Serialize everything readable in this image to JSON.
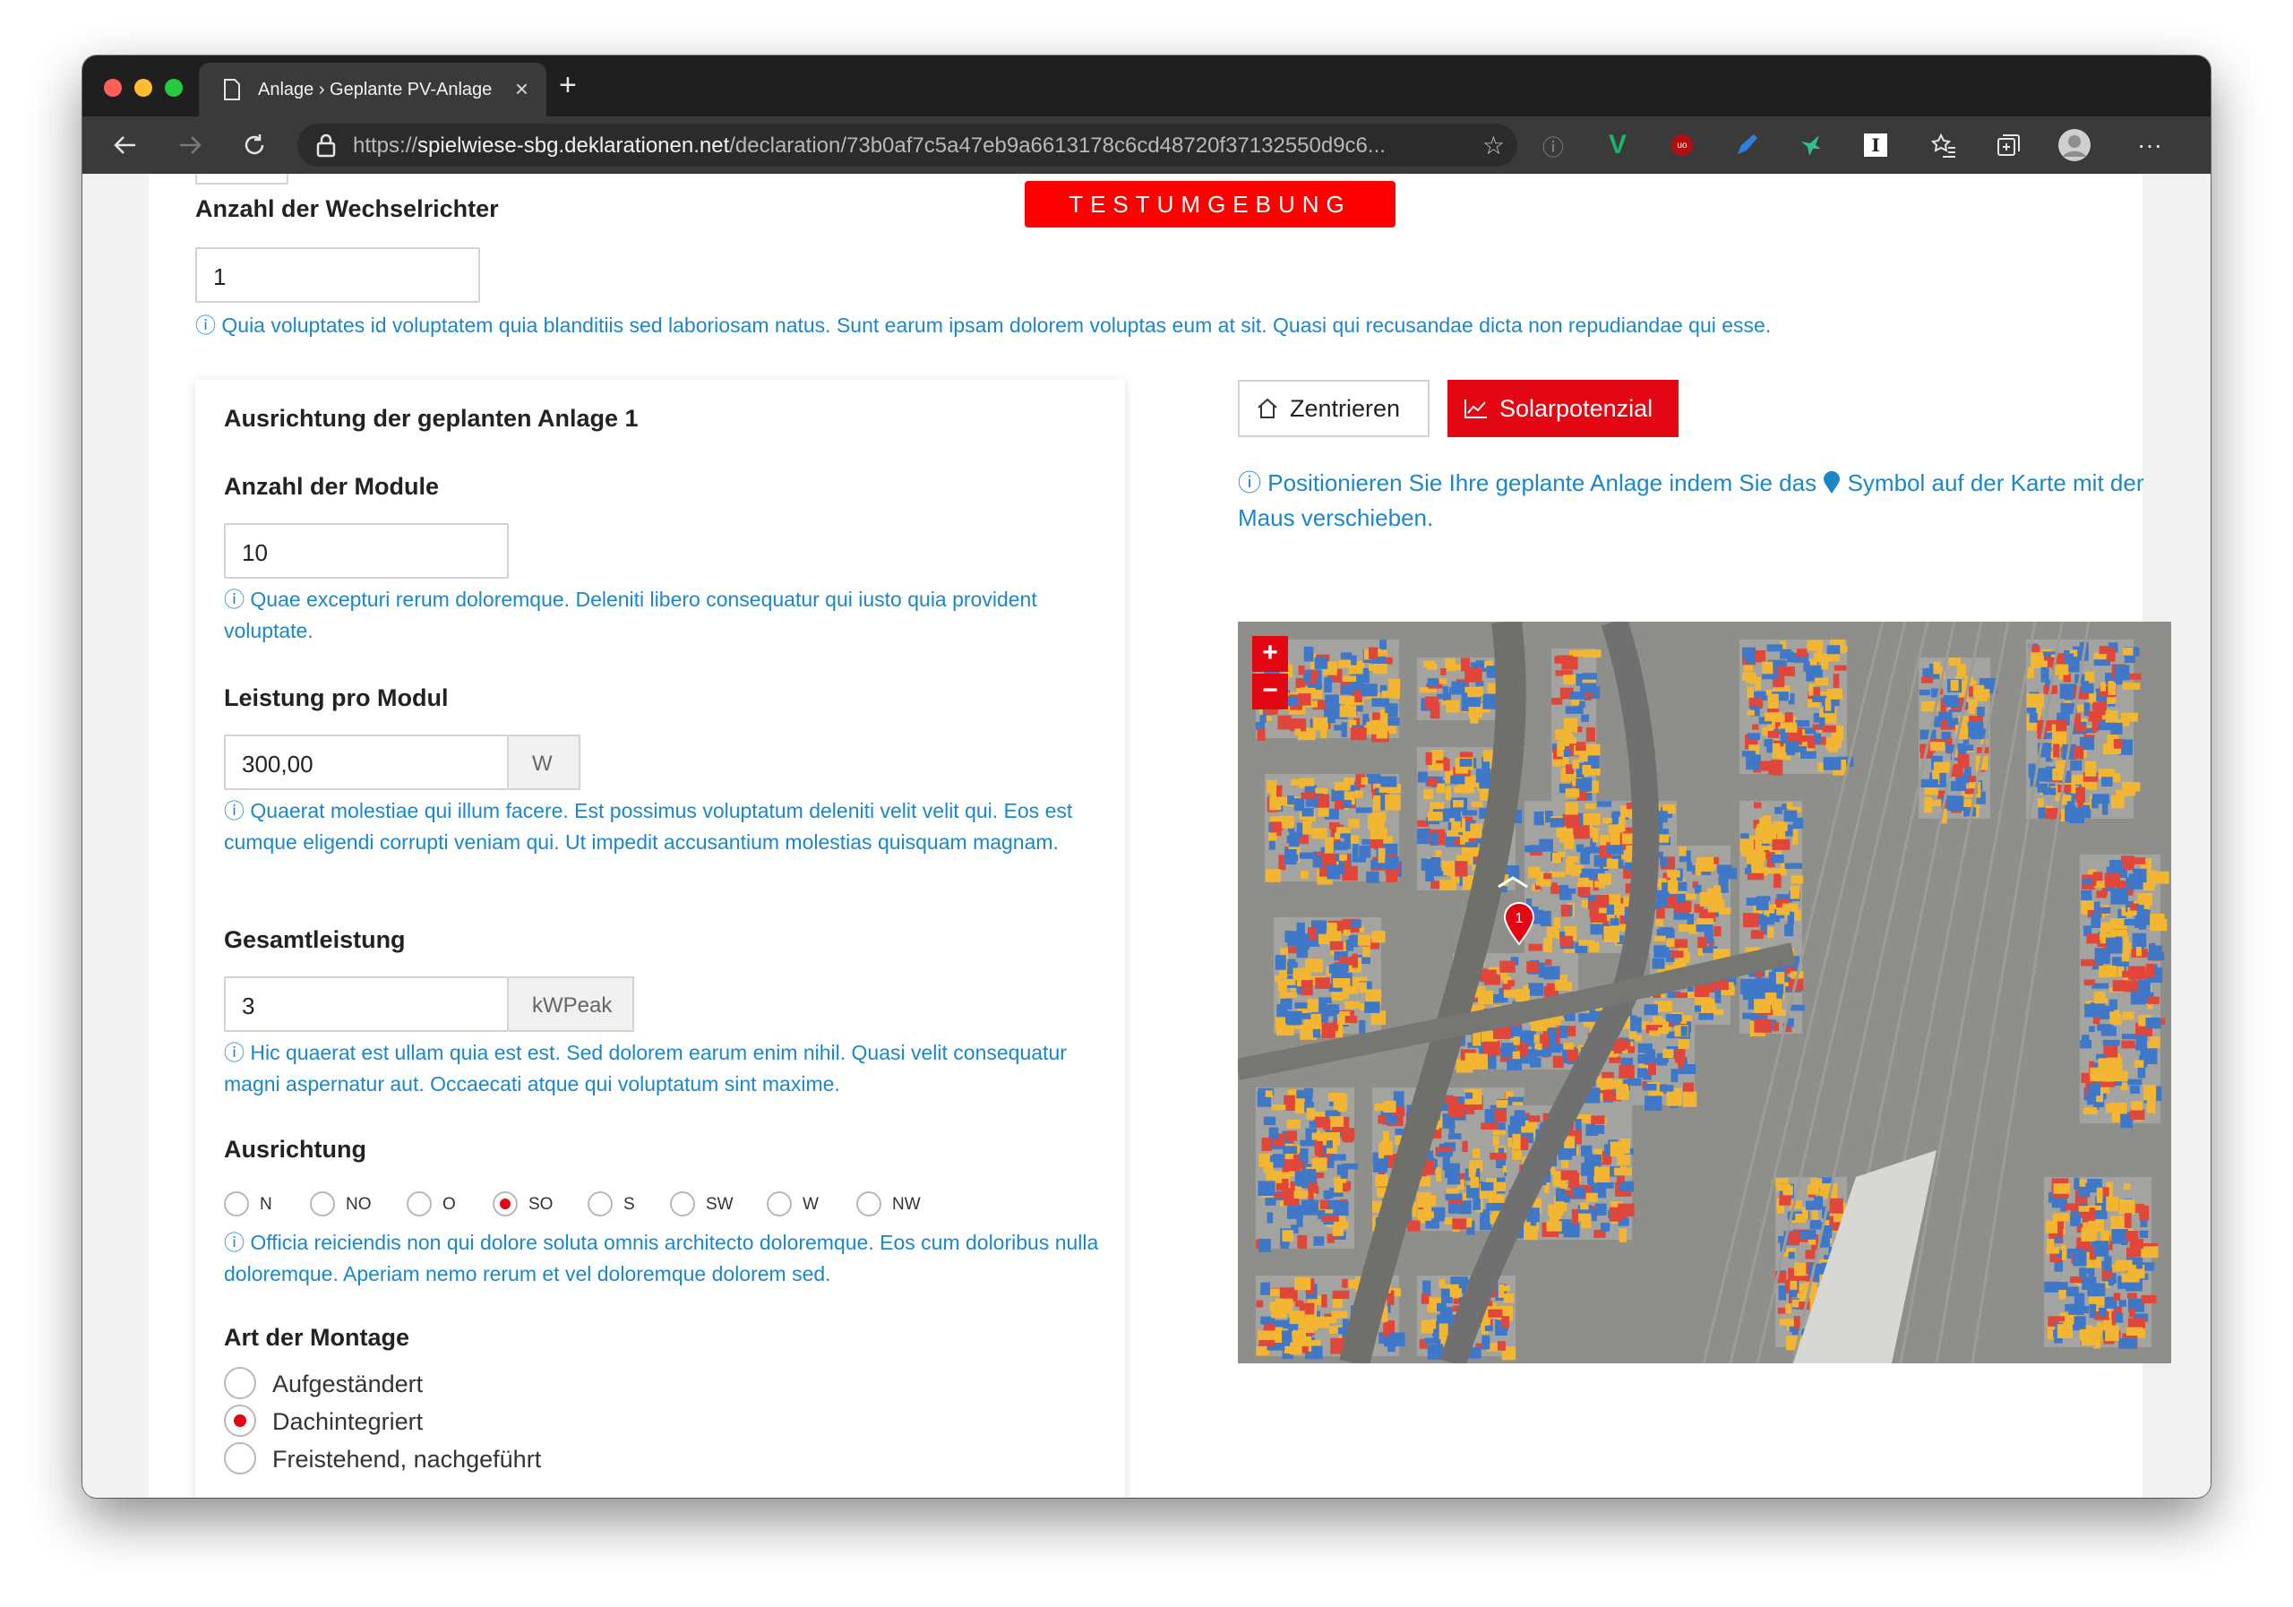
{
  "browser": {
    "tab_title": "Anlage › Geplante PV-Anlage",
    "tab_close": "×",
    "new_tab": "+",
    "url_scheme": "https://",
    "url_host": "spielwiese-sbg.deklarationen.net",
    "url_path": "/declaration/73b0af7c5a47eb9a6613178c6cd48720f37132550d9c6...",
    "icons": [
      "back-icon",
      "forward-icon",
      "reload-icon",
      "lock-icon",
      "star-icon",
      "info-icon",
      "vue-extension-icon",
      "ublock-icon",
      "pen-extension-icon",
      "bird-extension-icon",
      "instapaper-icon",
      "favorites-icon",
      "collections-icon",
      "profile-icon",
      "more-icon"
    ]
  },
  "page": {
    "test_banner": "TESTUMGEBUNG",
    "wechselrichter": {
      "label": "Anzahl der Wechselrichter",
      "value": "1",
      "hint": "ⓘ Quia voluptates id voluptatem quia blanditiis sed laboriosam natus. Sunt earum ipsam dolorem voluptas eum at sit. Quasi qui recusandae dicta non repudiandae qui esse."
    },
    "card": {
      "title": "Ausrichtung der geplanten Anlage 1",
      "module_count": {
        "label": "Anzahl der Module",
        "value": "10",
        "hint": "ⓘ Quae excepturi rerum doloremque. Deleniti libero consequatur qui iusto quia provident voluptate."
      },
      "module_power": {
        "label": "Leistung pro Modul",
        "value": "300,00",
        "unit": "W",
        "hint": "ⓘ Quaerat molestiae qui illum facere. Est possimus voluptatum deleniti velit velit qui. Eos est cumque eligendi corrupti veniam qui. Ut impedit accusantium molestias quisquam magnam."
      },
      "total_power": {
        "label": "Gesamtleistung",
        "value": "3",
        "unit": "kWPeak",
        "hint": "ⓘ Hic quaerat est ullam quia est est. Sed dolorem earum enim nihil. Quasi velit consequatur magni aspernatur aut. Occaecati atque qui voluptatum sint maxime."
      },
      "orientation": {
        "label": "Ausrichtung",
        "options": [
          "N",
          "NO",
          "O",
          "SO",
          "S",
          "SW",
          "W",
          "NW"
        ],
        "selected": "SO",
        "hint": "ⓘ Officia reiciendis non qui dolore soluta omnis architecto doloremque. Eos cum doloribus nulla doloremque. Aperiam nemo rerum et vel doloremque dolorem sed."
      },
      "mounting": {
        "label": "Art der Montage",
        "options": [
          "Aufgeständert",
          "Dachintegriert",
          "Freistehend, nachgeführt"
        ],
        "selected": "Dachintegriert"
      }
    },
    "map_panel": {
      "center_button": "Zentrieren",
      "solar_button": "Solarpotenzial",
      "hint_part1": "Positionieren Sie Ihre geplante Anlage indem Sie das",
      "hint_part2": "Symbol auf der Karte mit der Maus verschieben.",
      "zoom_in": "+",
      "zoom_out": "−",
      "marker_label": "1"
    },
    "colors": {
      "accent_red": "#e30613",
      "banner_red": "#ff0000",
      "hint_blue": "#1b87c9",
      "solar_blue": "#3f78c9",
      "solar_yellow": "#f2b632",
      "solar_red": "#e0473a"
    }
  }
}
